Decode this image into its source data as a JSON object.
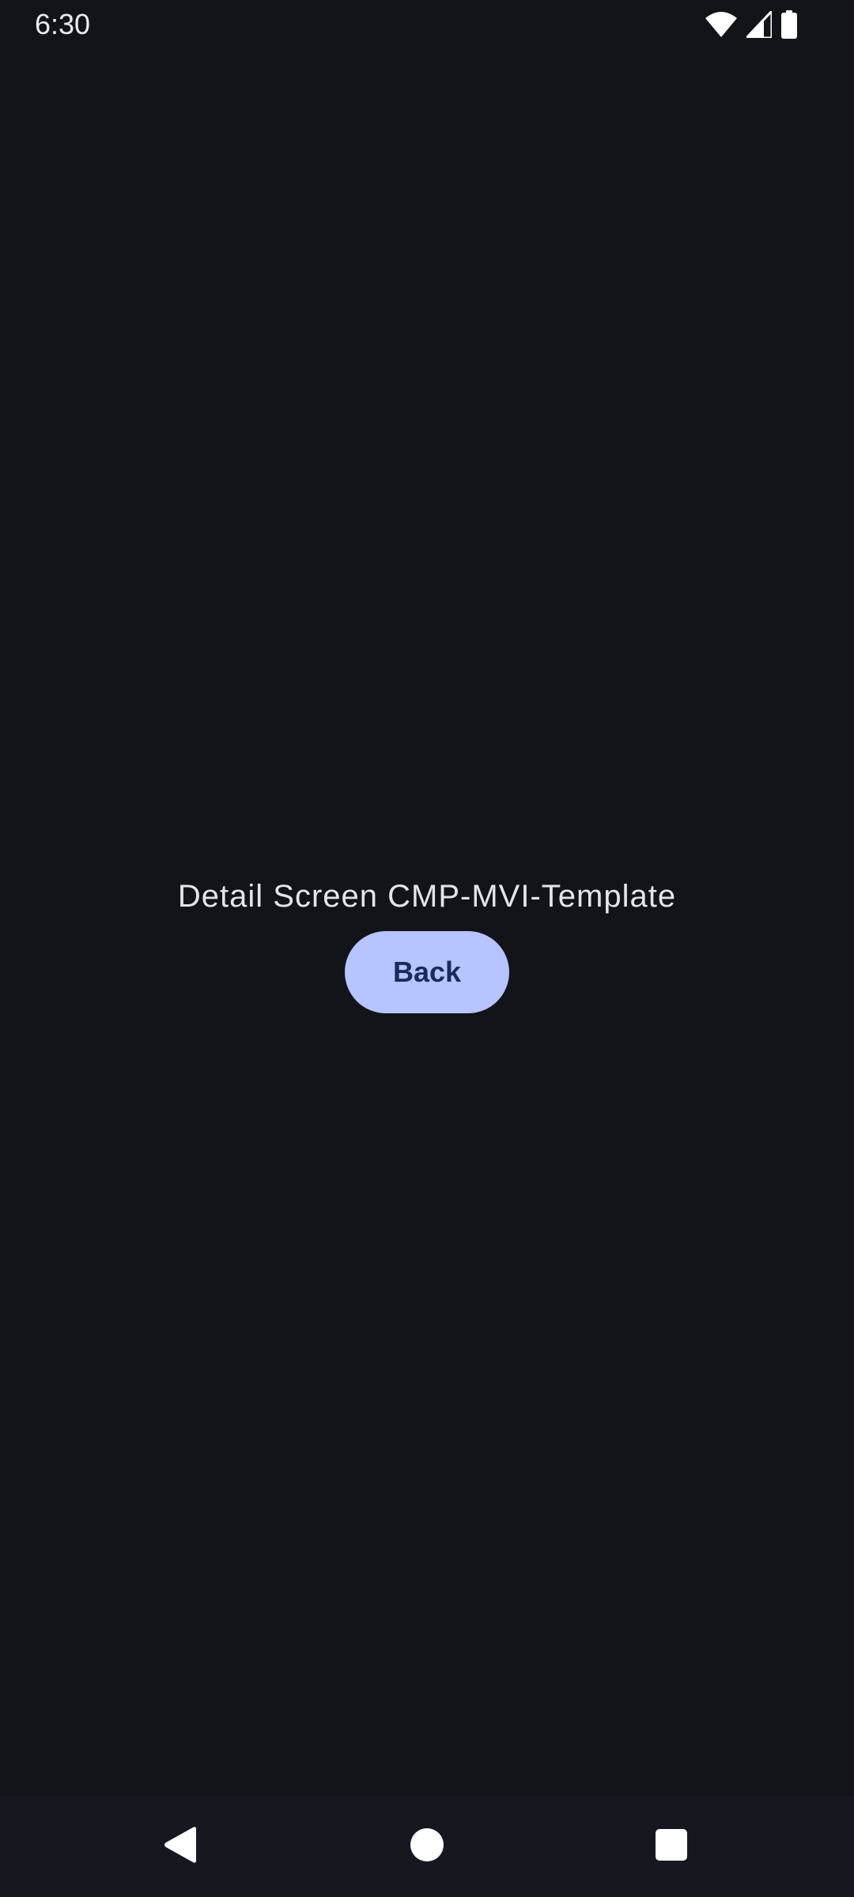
{
  "status_bar": {
    "time": "6:30",
    "icons": [
      "wifi-icon",
      "signal-icon",
      "battery-icon"
    ]
  },
  "main": {
    "title": "Detail Screen CMP-MVI-Template",
    "back_button_label": "Back"
  },
  "nav_bar": {
    "buttons": [
      "back-triangle-icon",
      "home-circle-icon",
      "recents-square-icon"
    ]
  },
  "colors": {
    "background": "#13141a",
    "button_background": "#b6c4ff",
    "button_text": "#1b2a5c",
    "text": "#e4e4ea"
  }
}
